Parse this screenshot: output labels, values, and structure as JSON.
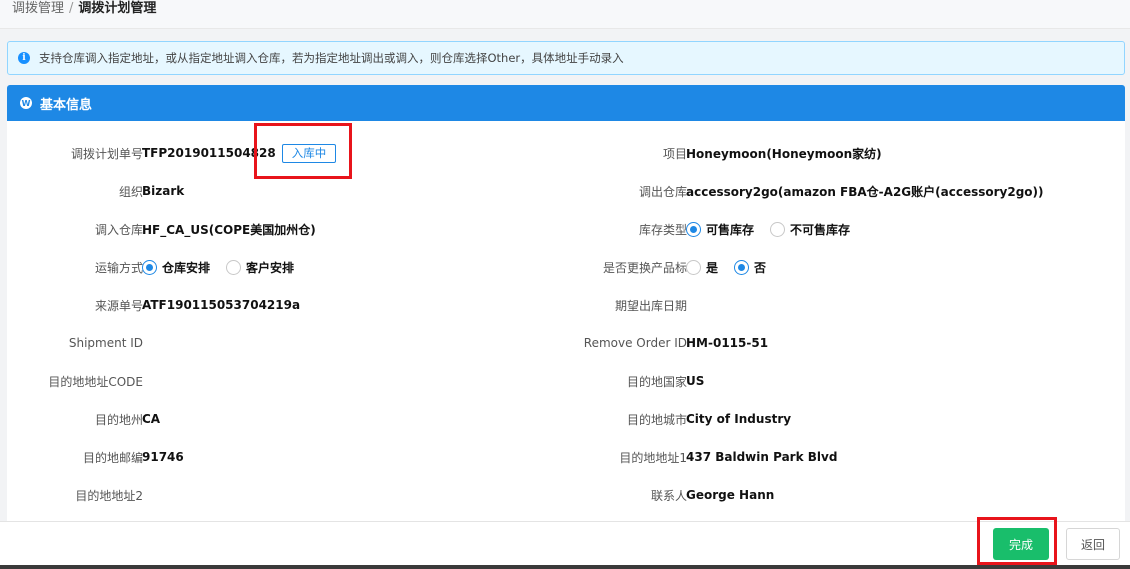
{
  "breadcrumb": {
    "parent": "调拨管理",
    "separator": "/",
    "current": "调拨计划管理"
  },
  "notice": {
    "icon": "info-icon",
    "text": "支持仓库调入指定地址，或从指定地址调入仓库，若为指定地址调出或调入，则仓库选择Other，具体地址手动录入"
  },
  "panel": {
    "icon": "wordpress-icon",
    "title": "基本信息"
  },
  "fields": {
    "plan_no": {
      "label": "调拨计划单号",
      "value": "TFP2019011504828",
      "status": "入库中"
    },
    "project": {
      "label": "项目",
      "value": "Honeymoon(Honeymoon家纺)"
    },
    "org": {
      "label": "组织",
      "value": "Bizark"
    },
    "out_warehouse": {
      "label": "调出仓库",
      "value": "accessory2go(amazon FBA仓-A2G账户(accessory2go))"
    },
    "in_warehouse": {
      "label": "调入仓库",
      "value": "HF_CA_US(COPE美国加州仓)"
    },
    "stock_type": {
      "label": "库存类型",
      "options": [
        "可售库存",
        "不可售库存"
      ],
      "selected": "可售库存"
    },
    "transport": {
      "label": "运输方式",
      "options": [
        "仓库安排",
        "客户安排"
      ],
      "selected": "仓库安排"
    },
    "replace_label": {
      "label": "是否更换产品标",
      "options": [
        "是",
        "否"
      ],
      "selected": "否"
    },
    "source_no": {
      "label": "来源单号",
      "value": "ATF190115053704219a"
    },
    "expected_date": {
      "label": "期望出库日期",
      "value": ""
    },
    "shipment_id": {
      "label": "Shipment ID",
      "value": ""
    },
    "remove_order_id": {
      "label": "Remove Order ID",
      "value": "HM-0115-51"
    },
    "dest_code": {
      "label": "目的地地址CODE",
      "value": ""
    },
    "dest_country": {
      "label": "目的地国家",
      "value": "US"
    },
    "dest_state": {
      "label": "目的地州",
      "value": "CA"
    },
    "dest_city": {
      "label": "目的地城市",
      "value": "City of Industry"
    },
    "dest_zip": {
      "label": "目的地邮编",
      "value": "91746"
    },
    "dest_addr1": {
      "label": "目的地地址1",
      "value": "437 Baldwin Park Blvd"
    },
    "dest_addr2": {
      "label": "目的地地址2",
      "value": ""
    },
    "contact": {
      "label": "联系人",
      "value": "George Hann"
    }
  },
  "footer": {
    "done_label": "完成",
    "back_label": "返回"
  },
  "colors": {
    "primary": "#1e88e5",
    "success": "#19be6b",
    "highlight": "#e8141b"
  }
}
